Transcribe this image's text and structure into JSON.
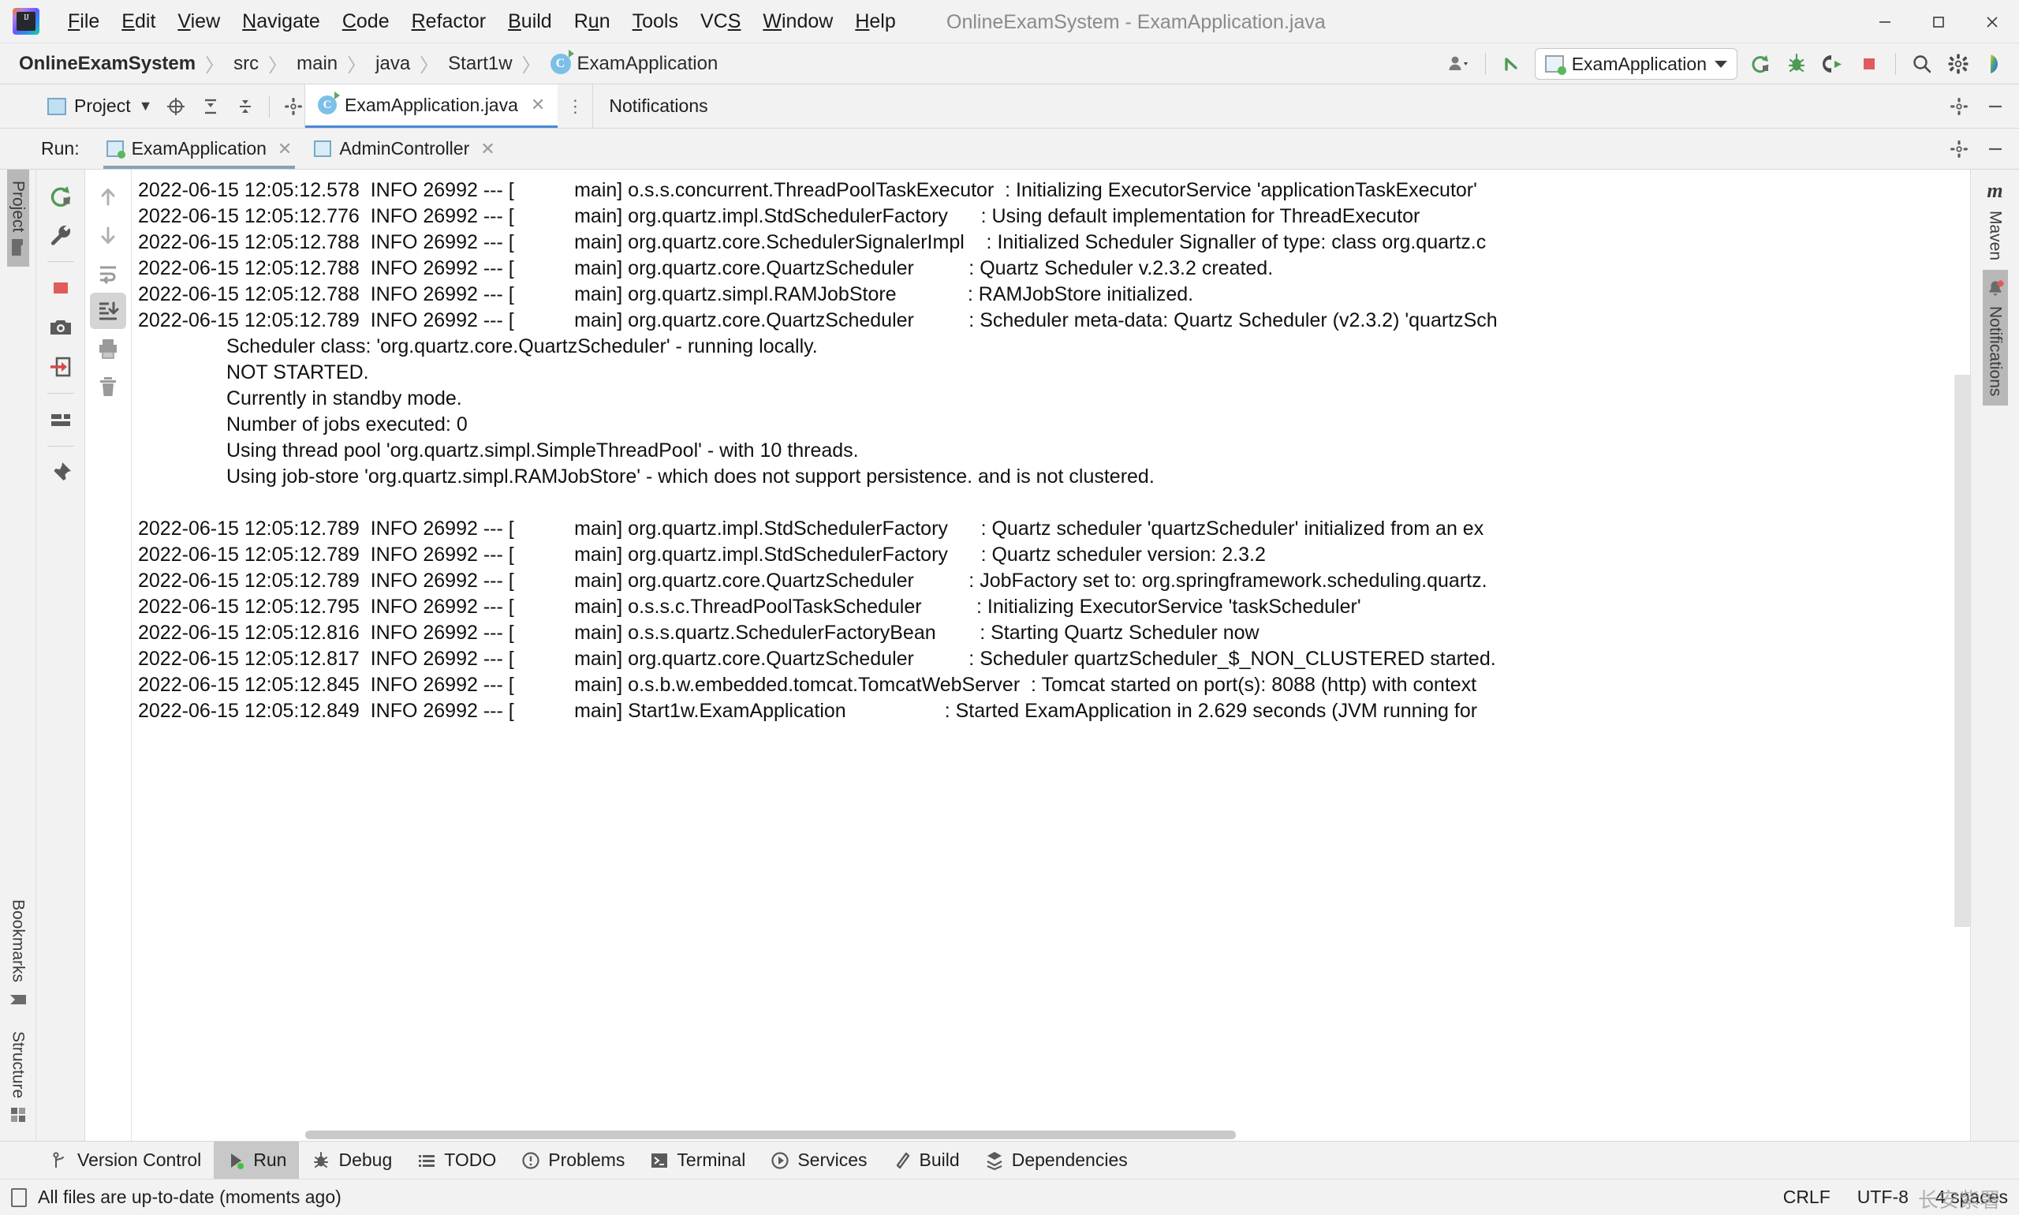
{
  "window": {
    "title": "OnlineExamSystem - ExamApplication.java",
    "minimize_label": "─",
    "maximize_label": "☐",
    "close_label": "✕"
  },
  "menu": {
    "items": [
      {
        "label": "File",
        "mnemonic": "F"
      },
      {
        "label": "Edit",
        "mnemonic": "E"
      },
      {
        "label": "View",
        "mnemonic": "V"
      },
      {
        "label": "Navigate",
        "mnemonic": "N"
      },
      {
        "label": "Code",
        "mnemonic": "C"
      },
      {
        "label": "Refactor",
        "mnemonic": "R"
      },
      {
        "label": "Build",
        "mnemonic": "B"
      },
      {
        "label": "Run",
        "mnemonic": "u"
      },
      {
        "label": "Tools",
        "mnemonic": "T"
      },
      {
        "label": "VCS",
        "mnemonic": "S"
      },
      {
        "label": "Window",
        "mnemonic": "W"
      },
      {
        "label": "Help",
        "mnemonic": "H"
      }
    ]
  },
  "breadcrumb": {
    "items": [
      "OnlineExamSystem",
      "src",
      "main",
      "java",
      "Start1w",
      "ExamApplication"
    ],
    "separator": "〉",
    "class_icon_letter": "C"
  },
  "toolbar": {
    "run_configuration": "ExamApplication",
    "buttons": [
      {
        "name": "user-account",
        "label": "\u0000"
      },
      {
        "name": "update-project",
        "label": "\u0000"
      },
      {
        "name": "run",
        "label": "\u0000"
      },
      {
        "name": "debug",
        "label": "\u0000"
      },
      {
        "name": "run-with-coverage",
        "label": "\u0000"
      },
      {
        "name": "stop",
        "label": "\u0000"
      },
      {
        "name": "search-everywhere",
        "label": "\u0000"
      },
      {
        "name": "settings",
        "label": "\u0000"
      },
      {
        "name": "ide-assistant",
        "label": "\u0000"
      }
    ]
  },
  "project_tool_window": {
    "title": "Project",
    "chevron": "▼"
  },
  "editor": {
    "tabs": [
      {
        "label": "ExamApplication.java",
        "close": "✕",
        "active": true
      }
    ],
    "kebab": "⋮"
  },
  "notifications_panel": {
    "title": "Notifications"
  },
  "run_tool_window": {
    "label": "Run:",
    "tabs": [
      {
        "label": "ExamApplication",
        "close": "✕",
        "active": true,
        "running": true
      },
      {
        "label": "AdminController",
        "close": "✕",
        "active": false,
        "running": false
      }
    ],
    "toolbar_buttons": [
      "rerun-icon",
      "settings-wrench-icon",
      "stop-icon",
      "camera-icon",
      "export-icon",
      "layout-icon",
      "pin-icon"
    ],
    "console_buttons": [
      "scroll-up-icon",
      "scroll-down-icon",
      "soft-wrap-icon",
      "scroll-to-end-icon",
      "print-icon",
      "trash-icon"
    ]
  },
  "left_rail": {
    "tabs": [
      {
        "label": "Project",
        "selected": true,
        "icon": "folder-icon"
      },
      {
        "label": "Bookmarks",
        "selected": false,
        "icon": "bookmark-icon"
      },
      {
        "label": "Structure",
        "selected": false,
        "icon": "structure-icon"
      }
    ]
  },
  "right_rail": {
    "tabs": [
      {
        "label": "Maven",
        "selected": false,
        "icon": "maven-icon"
      },
      {
        "label": "Notifications",
        "selected": true,
        "icon": "bell-icon"
      }
    ]
  },
  "console": {
    "lines": [
      {
        "ts": "2022-06-15 12:05:12.578",
        "level": "INFO",
        "pid": "26992",
        "thread": "main",
        "logger": "o.s.s.concurrent.ThreadPoolTaskExecutor",
        "msg": ": Initializing ExecutorService 'applicationTaskExecutor'"
      },
      {
        "ts": "2022-06-15 12:05:12.776",
        "level": "INFO",
        "pid": "26992",
        "thread": "main",
        "logger": "org.quartz.impl.StdSchedulerFactory",
        "msg": ": Using default implementation for ThreadExecutor"
      },
      {
        "ts": "2022-06-15 12:05:12.788",
        "level": "INFO",
        "pid": "26992",
        "thread": "main",
        "logger": "org.quartz.core.SchedulerSignalerImpl",
        "msg": ": Initialized Scheduler Signaller of type: class org.quartz.c"
      },
      {
        "ts": "2022-06-15 12:05:12.788",
        "level": "INFO",
        "pid": "26992",
        "thread": "main",
        "logger": "org.quartz.core.QuartzScheduler",
        "msg": ": Quartz Scheduler v.2.3.2 created."
      },
      {
        "ts": "2022-06-15 12:05:12.788",
        "level": "INFO",
        "pid": "26992",
        "thread": "main",
        "logger": "org.quartz.simpl.RAMJobStore",
        "msg": ": RAMJobStore initialized."
      },
      {
        "ts": "2022-06-15 12:05:12.789",
        "level": "INFO",
        "pid": "26992",
        "thread": "main",
        "logger": "org.quartz.core.QuartzScheduler",
        "msg": ": Scheduler meta-data: Quartz Scheduler (v2.3.2) 'quartzSch"
      }
    ],
    "detail_lines": [
      "Scheduler class: 'org.quartz.core.QuartzScheduler' - running locally.",
      "NOT STARTED.",
      "Currently in standby mode.",
      "Number of jobs executed: 0",
      "Using thread pool 'org.quartz.simpl.SimpleThreadPool' - with 10 threads.",
      "Using job-store 'org.quartz.simpl.RAMJobStore' - which does not support persistence. and is not clustered."
    ],
    "lines2": [
      {
        "ts": "2022-06-15 12:05:12.789",
        "level": "INFO",
        "pid": "26992",
        "thread": "main",
        "logger": "org.quartz.impl.StdSchedulerFactory",
        "msg": ": Quartz scheduler 'quartzScheduler' initialized from an ex"
      },
      {
        "ts": "2022-06-15 12:05:12.789",
        "level": "INFO",
        "pid": "26992",
        "thread": "main",
        "logger": "org.quartz.impl.StdSchedulerFactory",
        "msg": ": Quartz scheduler version: 2.3.2"
      },
      {
        "ts": "2022-06-15 12:05:12.789",
        "level": "INFO",
        "pid": "26992",
        "thread": "main",
        "logger": "org.quartz.core.QuartzScheduler",
        "msg": ": JobFactory set to: org.springframework.scheduling.quartz."
      },
      {
        "ts": "2022-06-15 12:05:12.795",
        "level": "INFO",
        "pid": "26992",
        "thread": "main",
        "logger": "o.s.s.c.ThreadPoolTaskScheduler",
        "msg": ": Initializing ExecutorService 'taskScheduler'"
      },
      {
        "ts": "2022-06-15 12:05:12.816",
        "level": "INFO",
        "pid": "26992",
        "thread": "main",
        "logger": "o.s.s.quartz.SchedulerFactoryBean",
        "msg": ": Starting Quartz Scheduler now"
      },
      {
        "ts": "2022-06-15 12:05:12.817",
        "level": "INFO",
        "pid": "26992",
        "thread": "main",
        "logger": "org.quartz.core.QuartzScheduler",
        "msg": ": Scheduler quartzScheduler_$_NON_CLUSTERED started."
      },
      {
        "ts": "2022-06-15 12:05:12.845",
        "level": "INFO",
        "pid": "26992",
        "thread": "main",
        "logger": "o.s.b.w.embedded.tomcat.TomcatWebServer",
        "msg": ": Tomcat started on port(s): 8088 (http) with context"
      },
      {
        "ts": "2022-06-15 12:05:12.849",
        "level": "INFO",
        "pid": "26992",
        "thread": "main",
        "logger": "Start1w.ExamApplication",
        "msg": ": Started ExamApplication in 2.629 seconds (JVM running for"
      }
    ]
  },
  "bottom_tabs": [
    {
      "label": "Version Control",
      "icon": "branch-icon",
      "active": false
    },
    {
      "label": "Run",
      "icon": "play-icon",
      "active": true
    },
    {
      "label": "Debug",
      "icon": "bug-icon",
      "active": false
    },
    {
      "label": "TODO",
      "icon": "list-icon",
      "active": false
    },
    {
      "label": "Problems",
      "icon": "warning-icon",
      "active": false
    },
    {
      "label": "Terminal",
      "icon": "terminal-icon",
      "active": false
    },
    {
      "label": "Services",
      "icon": "services-icon",
      "active": false
    },
    {
      "label": "Build",
      "icon": "hammer-icon",
      "active": false
    },
    {
      "label": "Dependencies",
      "icon": "dependencies-icon",
      "active": false
    }
  ],
  "statusbar": {
    "message": "All files are up-to-date (moments ago)",
    "line_separator": "CRLF",
    "encoding": "UTF-8",
    "indent": "4 spaces",
    "watermark": "长安紫署"
  }
}
